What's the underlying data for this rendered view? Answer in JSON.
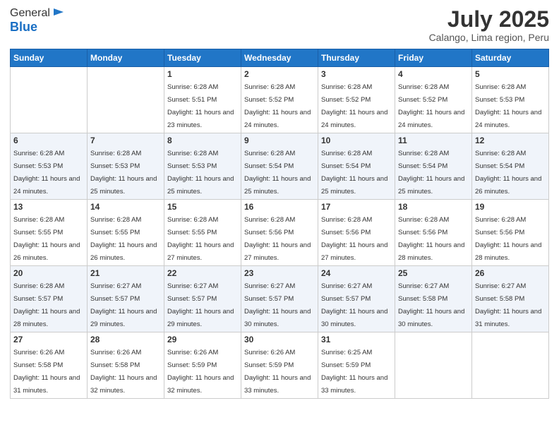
{
  "logo": {
    "general": "General",
    "blue": "Blue"
  },
  "header": {
    "title": "July 2025",
    "subtitle": "Calango, Lima region, Peru"
  },
  "weekdays": [
    "Sunday",
    "Monday",
    "Tuesday",
    "Wednesday",
    "Thursday",
    "Friday",
    "Saturday"
  ],
  "weeks": [
    [
      {
        "day": "",
        "sunrise": "",
        "sunset": "",
        "daylight": ""
      },
      {
        "day": "",
        "sunrise": "",
        "sunset": "",
        "daylight": ""
      },
      {
        "day": "1",
        "sunrise": "Sunrise: 6:28 AM",
        "sunset": "Sunset: 5:51 PM",
        "daylight": "Daylight: 11 hours and 23 minutes."
      },
      {
        "day": "2",
        "sunrise": "Sunrise: 6:28 AM",
        "sunset": "Sunset: 5:52 PM",
        "daylight": "Daylight: 11 hours and 24 minutes."
      },
      {
        "day": "3",
        "sunrise": "Sunrise: 6:28 AM",
        "sunset": "Sunset: 5:52 PM",
        "daylight": "Daylight: 11 hours and 24 minutes."
      },
      {
        "day": "4",
        "sunrise": "Sunrise: 6:28 AM",
        "sunset": "Sunset: 5:52 PM",
        "daylight": "Daylight: 11 hours and 24 minutes."
      },
      {
        "day": "5",
        "sunrise": "Sunrise: 6:28 AM",
        "sunset": "Sunset: 5:53 PM",
        "daylight": "Daylight: 11 hours and 24 minutes."
      }
    ],
    [
      {
        "day": "6",
        "sunrise": "Sunrise: 6:28 AM",
        "sunset": "Sunset: 5:53 PM",
        "daylight": "Daylight: 11 hours and 24 minutes."
      },
      {
        "day": "7",
        "sunrise": "Sunrise: 6:28 AM",
        "sunset": "Sunset: 5:53 PM",
        "daylight": "Daylight: 11 hours and 25 minutes."
      },
      {
        "day": "8",
        "sunrise": "Sunrise: 6:28 AM",
        "sunset": "Sunset: 5:53 PM",
        "daylight": "Daylight: 11 hours and 25 minutes."
      },
      {
        "day": "9",
        "sunrise": "Sunrise: 6:28 AM",
        "sunset": "Sunset: 5:54 PM",
        "daylight": "Daylight: 11 hours and 25 minutes."
      },
      {
        "day": "10",
        "sunrise": "Sunrise: 6:28 AM",
        "sunset": "Sunset: 5:54 PM",
        "daylight": "Daylight: 11 hours and 25 minutes."
      },
      {
        "day": "11",
        "sunrise": "Sunrise: 6:28 AM",
        "sunset": "Sunset: 5:54 PM",
        "daylight": "Daylight: 11 hours and 25 minutes."
      },
      {
        "day": "12",
        "sunrise": "Sunrise: 6:28 AM",
        "sunset": "Sunset: 5:54 PM",
        "daylight": "Daylight: 11 hours and 26 minutes."
      }
    ],
    [
      {
        "day": "13",
        "sunrise": "Sunrise: 6:28 AM",
        "sunset": "Sunset: 5:55 PM",
        "daylight": "Daylight: 11 hours and 26 minutes."
      },
      {
        "day": "14",
        "sunrise": "Sunrise: 6:28 AM",
        "sunset": "Sunset: 5:55 PM",
        "daylight": "Daylight: 11 hours and 26 minutes."
      },
      {
        "day": "15",
        "sunrise": "Sunrise: 6:28 AM",
        "sunset": "Sunset: 5:55 PM",
        "daylight": "Daylight: 11 hours and 27 minutes."
      },
      {
        "day": "16",
        "sunrise": "Sunrise: 6:28 AM",
        "sunset": "Sunset: 5:56 PM",
        "daylight": "Daylight: 11 hours and 27 minutes."
      },
      {
        "day": "17",
        "sunrise": "Sunrise: 6:28 AM",
        "sunset": "Sunset: 5:56 PM",
        "daylight": "Daylight: 11 hours and 27 minutes."
      },
      {
        "day": "18",
        "sunrise": "Sunrise: 6:28 AM",
        "sunset": "Sunset: 5:56 PM",
        "daylight": "Daylight: 11 hours and 28 minutes."
      },
      {
        "day": "19",
        "sunrise": "Sunrise: 6:28 AM",
        "sunset": "Sunset: 5:56 PM",
        "daylight": "Daylight: 11 hours and 28 minutes."
      }
    ],
    [
      {
        "day": "20",
        "sunrise": "Sunrise: 6:28 AM",
        "sunset": "Sunset: 5:57 PM",
        "daylight": "Daylight: 11 hours and 28 minutes."
      },
      {
        "day": "21",
        "sunrise": "Sunrise: 6:27 AM",
        "sunset": "Sunset: 5:57 PM",
        "daylight": "Daylight: 11 hours and 29 minutes."
      },
      {
        "day": "22",
        "sunrise": "Sunrise: 6:27 AM",
        "sunset": "Sunset: 5:57 PM",
        "daylight": "Daylight: 11 hours and 29 minutes."
      },
      {
        "day": "23",
        "sunrise": "Sunrise: 6:27 AM",
        "sunset": "Sunset: 5:57 PM",
        "daylight": "Daylight: 11 hours and 30 minutes."
      },
      {
        "day": "24",
        "sunrise": "Sunrise: 6:27 AM",
        "sunset": "Sunset: 5:57 PM",
        "daylight": "Daylight: 11 hours and 30 minutes."
      },
      {
        "day": "25",
        "sunrise": "Sunrise: 6:27 AM",
        "sunset": "Sunset: 5:58 PM",
        "daylight": "Daylight: 11 hours and 30 minutes."
      },
      {
        "day": "26",
        "sunrise": "Sunrise: 6:27 AM",
        "sunset": "Sunset: 5:58 PM",
        "daylight": "Daylight: 11 hours and 31 minutes."
      }
    ],
    [
      {
        "day": "27",
        "sunrise": "Sunrise: 6:26 AM",
        "sunset": "Sunset: 5:58 PM",
        "daylight": "Daylight: 11 hours and 31 minutes."
      },
      {
        "day": "28",
        "sunrise": "Sunrise: 6:26 AM",
        "sunset": "Sunset: 5:58 PM",
        "daylight": "Daylight: 11 hours and 32 minutes."
      },
      {
        "day": "29",
        "sunrise": "Sunrise: 6:26 AM",
        "sunset": "Sunset: 5:59 PM",
        "daylight": "Daylight: 11 hours and 32 minutes."
      },
      {
        "day": "30",
        "sunrise": "Sunrise: 6:26 AM",
        "sunset": "Sunset: 5:59 PM",
        "daylight": "Daylight: 11 hours and 33 minutes."
      },
      {
        "day": "31",
        "sunrise": "Sunrise: 6:25 AM",
        "sunset": "Sunset: 5:59 PM",
        "daylight": "Daylight: 11 hours and 33 minutes."
      },
      {
        "day": "",
        "sunrise": "",
        "sunset": "",
        "daylight": ""
      },
      {
        "day": "",
        "sunrise": "",
        "sunset": "",
        "daylight": ""
      }
    ]
  ]
}
